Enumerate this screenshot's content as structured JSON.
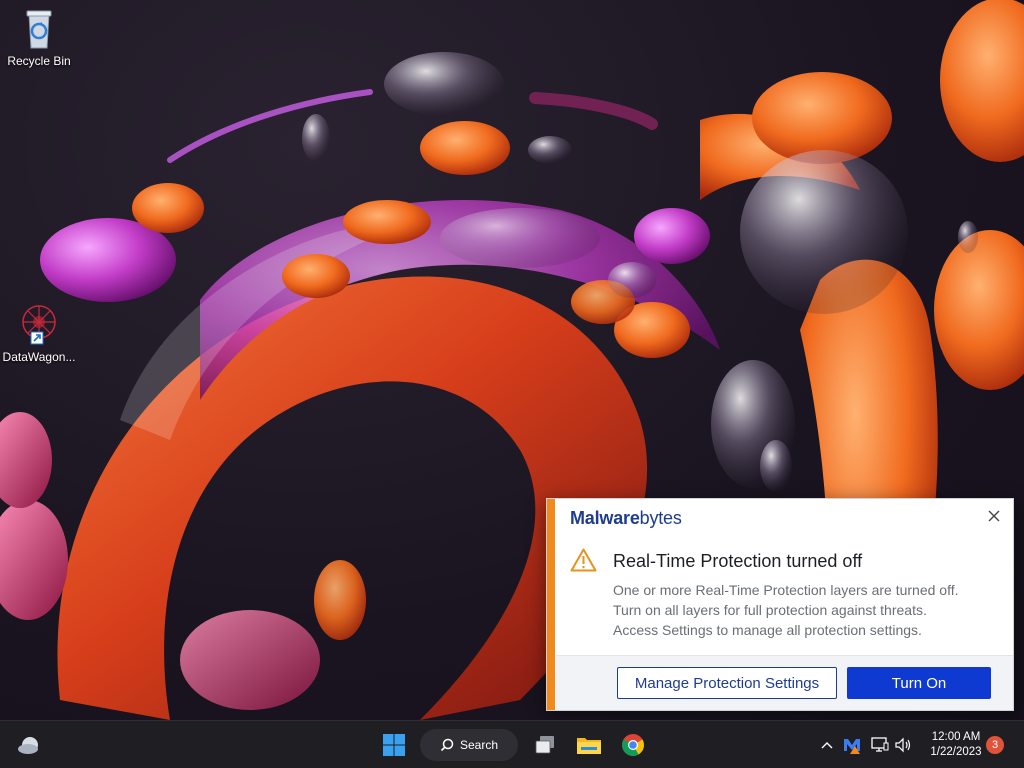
{
  "desktop": {
    "icons": [
      {
        "label": "Recycle Bin",
        "icon": "recycle-bin-icon"
      },
      {
        "label": "DataWagon...",
        "icon": "datawagon-shortcut-icon"
      }
    ]
  },
  "toast": {
    "brand_bold": "Malware",
    "brand_light": "bytes",
    "title": "Real-Time Protection turned off",
    "body_lines": [
      "One or more Real-Time Protection layers are turned off.",
      "Turn on all layers for full protection against threats.",
      "Access Settings to manage all protection settings."
    ],
    "secondary_button": "Manage Protection Settings",
    "primary_button": "Turn On",
    "accent_color": "#f08a1c",
    "brand_color": "#1e3d8f",
    "primary_color": "#0e3ad1"
  },
  "taskbar": {
    "search_label": "Search",
    "clock_time": "12:00 AM",
    "clock_date": "1/22/2023",
    "notification_count": "3"
  }
}
